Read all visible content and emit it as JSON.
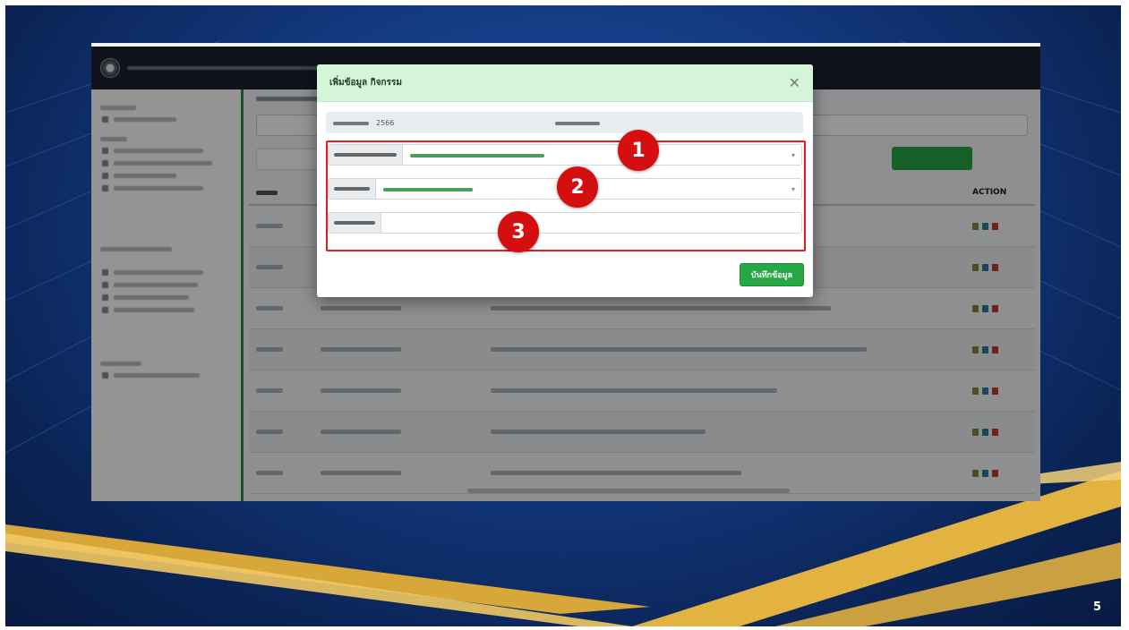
{
  "slide": {
    "number": "5",
    "background_color": "#0b2558",
    "accent_color": "#e3b341"
  },
  "app": {
    "table_header_action": "ACTION"
  },
  "modal": {
    "title": "เพิ่มข้อมูล กิจกรรม",
    "year_value": "2566",
    "save_label": "บันทึกข้อมูล"
  },
  "annotations": {
    "highlight_color": "#e02020",
    "steps": [
      "1",
      "2",
      "3"
    ]
  },
  "colors": {
    "header_dark": "#1c2230",
    "primary_green": "#28a745",
    "modal_header": "#d4f5d8"
  }
}
